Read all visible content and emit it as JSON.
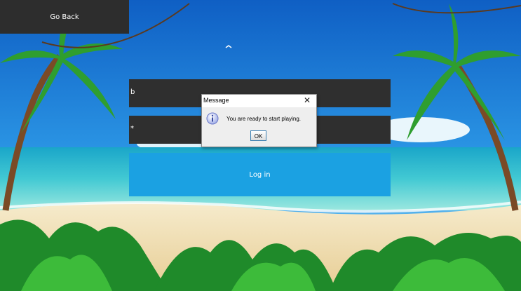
{
  "nav": {
    "back_label": "Go Back"
  },
  "form": {
    "username_value": "b",
    "password_value": "*",
    "login_label": "Log in"
  },
  "dialog": {
    "title": "Message",
    "message": "You are ready to start playing.",
    "ok_label": "OK"
  },
  "colors": {
    "dark_panel": "#2d2d2d",
    "login_button": "#1ba1e2",
    "sky": "#1e7fd6",
    "sea": "#37c6d4",
    "sand": "#f3e2b8"
  }
}
